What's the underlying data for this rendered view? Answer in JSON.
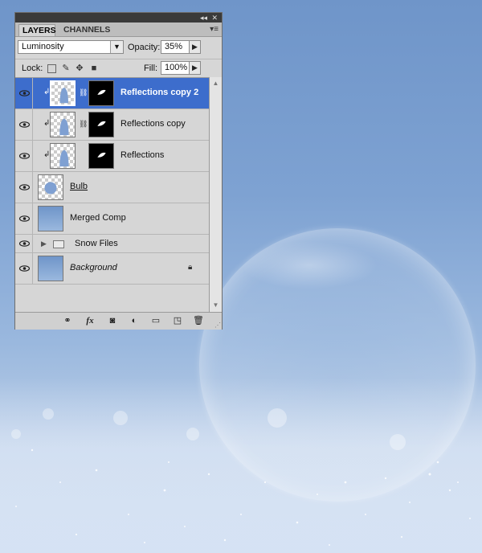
{
  "panel": {
    "tabs": [
      {
        "label": "LAYERS",
        "active": true
      },
      {
        "label": "CHANNELS",
        "active": false
      }
    ],
    "blend_mode": "Luminosity",
    "opacity_label": "Opacity:",
    "opacity_value": "35%",
    "lock_label": "Lock:",
    "fill_label": "Fill:",
    "fill_value": "100%",
    "lock_icons": [
      "lock-transparent-icon",
      "lock-paint-icon",
      "lock-position-icon",
      "lock-all-icon"
    ]
  },
  "layers": [
    {
      "name": "Reflections copy 2",
      "selected": true,
      "clipped": true,
      "has_mask": true,
      "linked": true
    },
    {
      "name": "Reflections copy",
      "selected": false,
      "clipped": true,
      "has_mask": true,
      "linked": true
    },
    {
      "name": "Reflections",
      "selected": false,
      "clipped": true,
      "has_mask": true,
      "linked": false
    },
    {
      "name": "Bulb",
      "selected": false,
      "underlined": true
    },
    {
      "name": "Merged Comp",
      "selected": false
    },
    {
      "name": "Snow Files",
      "group": true,
      "collapsed": true
    },
    {
      "name": "Background",
      "selected": false,
      "italic": true,
      "locked": true
    }
  ],
  "bottom_icons": [
    "link-layers-icon",
    "fx-icon",
    "add-mask-icon",
    "adjustment-layer-icon",
    "new-group-icon",
    "new-layer-icon",
    "trash-icon"
  ],
  "colors": {
    "selection": "#3d6dcc",
    "panel_bg": "#d6d6d6",
    "sky": "#6f95c9"
  }
}
